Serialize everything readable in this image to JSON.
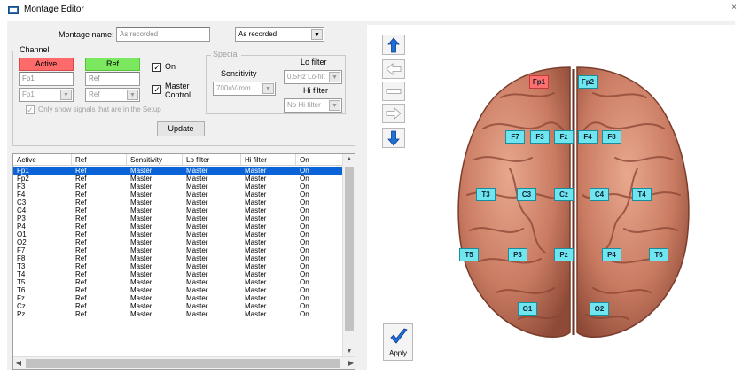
{
  "window": {
    "title": "Montage Editor",
    "close_glyph": "×"
  },
  "montage": {
    "name_label": "Montage name:",
    "name_value": "As recorded",
    "preset_value": "As recorded"
  },
  "channel": {
    "group_label": "Channel",
    "active_header": "Active",
    "ref_header": "Ref",
    "active_value": "Fp1",
    "ref_value": "Ref",
    "active_select": "Fp1",
    "ref_select": "Ref",
    "on_label": "On",
    "on_checked": true,
    "master_label_line1": "Master",
    "master_label_line2": "Control",
    "master_checked": true,
    "only_show_label": "Only show signals that are in the Setup",
    "only_show_checked": true,
    "update_button": "Update"
  },
  "special": {
    "group_label": "Special",
    "sensitivity_label": "Sensitivity",
    "sensitivity_value": "700uV/mm",
    "lo_filter_label": "Lo filter",
    "lo_filter_value": "0.5Hz Lo-filt",
    "hi_filter_label": "Hi filter",
    "hi_filter_value": "No Hi-filter"
  },
  "table": {
    "columns": [
      "Active",
      "Ref",
      "Sensitivity",
      "Lo filter",
      "Hi filter",
      "On"
    ],
    "rows": [
      [
        "Fp1",
        "Ref",
        "Master",
        "Master",
        "Master",
        "On"
      ],
      [
        "Fp2",
        "Ref",
        "Master",
        "Master",
        "Master",
        "On"
      ],
      [
        "F3",
        "Ref",
        "Master",
        "Master",
        "Master",
        "On"
      ],
      [
        "F4",
        "Ref",
        "Master",
        "Master",
        "Master",
        "On"
      ],
      [
        "C3",
        "Ref",
        "Master",
        "Master",
        "Master",
        "On"
      ],
      [
        "C4",
        "Ref",
        "Master",
        "Master",
        "Master",
        "On"
      ],
      [
        "P3",
        "Ref",
        "Master",
        "Master",
        "Master",
        "On"
      ],
      [
        "P4",
        "Ref",
        "Master",
        "Master",
        "Master",
        "On"
      ],
      [
        "O1",
        "Ref",
        "Master",
        "Master",
        "Master",
        "On"
      ],
      [
        "O2",
        "Ref",
        "Master",
        "Master",
        "Master",
        "On"
      ],
      [
        "F7",
        "Ref",
        "Master",
        "Master",
        "Master",
        "On"
      ],
      [
        "F8",
        "Ref",
        "Master",
        "Master",
        "Master",
        "On"
      ],
      [
        "T3",
        "Ref",
        "Master",
        "Master",
        "Master",
        "On"
      ],
      [
        "T4",
        "Ref",
        "Master",
        "Master",
        "Master",
        "On"
      ],
      [
        "T5",
        "Ref",
        "Master",
        "Master",
        "Master",
        "On"
      ],
      [
        "T6",
        "Ref",
        "Master",
        "Master",
        "Master",
        "On"
      ],
      [
        "Fz",
        "Ref",
        "Master",
        "Master",
        "Master",
        "On"
      ],
      [
        "Cz",
        "Ref",
        "Master",
        "Master",
        "Master",
        "On"
      ],
      [
        "Pz",
        "Ref",
        "Master",
        "Master",
        "Master",
        "On"
      ]
    ],
    "selected_row": 0
  },
  "side_buttons": {
    "move_up_icon": "arrow-up-icon",
    "move_left_icon": "arrow-left-icon",
    "remove_icon": "minus-icon",
    "move_right_icon": "arrow-right-icon",
    "move_down_icon": "arrow-down-icon",
    "apply_label": "Apply",
    "apply_icon": "checkmark-icon"
  },
  "electrodes": {
    "Fp1": "Fp1",
    "Fp2": "Fp2",
    "F7": "F7",
    "F3": "F3",
    "Fz": "Fz",
    "F4": "F4",
    "F8": "F8",
    "T3": "T3",
    "C3": "C3",
    "Cz": "Cz",
    "C4": "C4",
    "T4": "T4",
    "T5": "T5",
    "P3": "P3",
    "Pz": "Pz",
    "P4": "P4",
    "T6": "T6",
    "O1": "O1",
    "O2": "O2",
    "active": "Fp1"
  },
  "colors": {
    "active_header": "#ff6b6b",
    "ref_header": "#7ce85f",
    "electrode": "#6fe5ef",
    "electrode_active": "#ff6f6f",
    "selection": "#0a64d8",
    "arrow_blue": "#1f6fd8",
    "brain": "#c97b62"
  }
}
